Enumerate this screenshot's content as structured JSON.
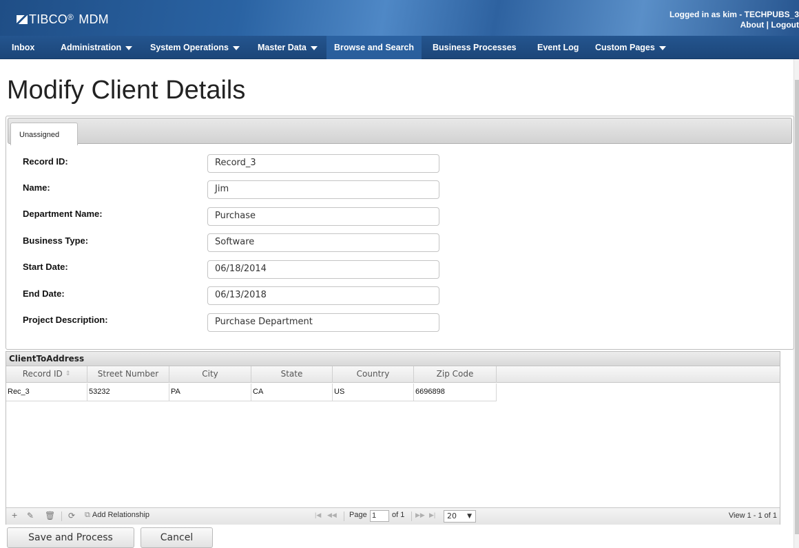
{
  "header": {
    "logo_text": "TIBCO",
    "logo_reg": "®",
    "product": "MDM",
    "logged_in_text": "Logged in as  kim - TECHPUBS_3",
    "about_label": "About",
    "separator": "|",
    "logout_label": "Logout"
  },
  "nav": {
    "items": [
      {
        "label": "Inbox"
      },
      {
        "label": "Administration"
      },
      {
        "label": "System Operations"
      },
      {
        "label": "Master Data"
      },
      {
        "label": "Browse and Search"
      },
      {
        "label": "Business Processes"
      },
      {
        "label": "Event Log"
      },
      {
        "label": "Custom Pages"
      }
    ]
  },
  "page": {
    "title": "Modify Client Details"
  },
  "tabs": {
    "active": "Unassigned"
  },
  "form": {
    "fields": [
      {
        "label": "Record ID:",
        "value": "Record_3"
      },
      {
        "label": "Name:",
        "value": "Jim"
      },
      {
        "label": "Department Name:",
        "value": "Purchase"
      },
      {
        "label": "Business Type:",
        "value": "Software"
      },
      {
        "label": "Start Date:",
        "value": "06/18/2014"
      },
      {
        "label": "End Date:",
        "value": "06/13/2018"
      },
      {
        "label": "Project Description:",
        "value": "Purchase Department"
      }
    ]
  },
  "grid": {
    "title": "ClientToAddress",
    "columns": [
      "Record ID",
      "Street Number",
      "City",
      "State",
      "Country",
      "Zip Code"
    ],
    "rows": [
      [
        "Rec_3",
        "53232",
        "PA",
        "CA",
        "US",
        "6696898"
      ]
    ],
    "toolbar": {
      "add_relationship": "Add Relationship"
    },
    "pager": {
      "page_label": "Page",
      "page_value": "1",
      "of_label": "of 1",
      "page_size": "20",
      "view_text": "View 1 - 1 of 1"
    }
  },
  "buttons": {
    "save": "Save and Process",
    "cancel": "Cancel"
  }
}
